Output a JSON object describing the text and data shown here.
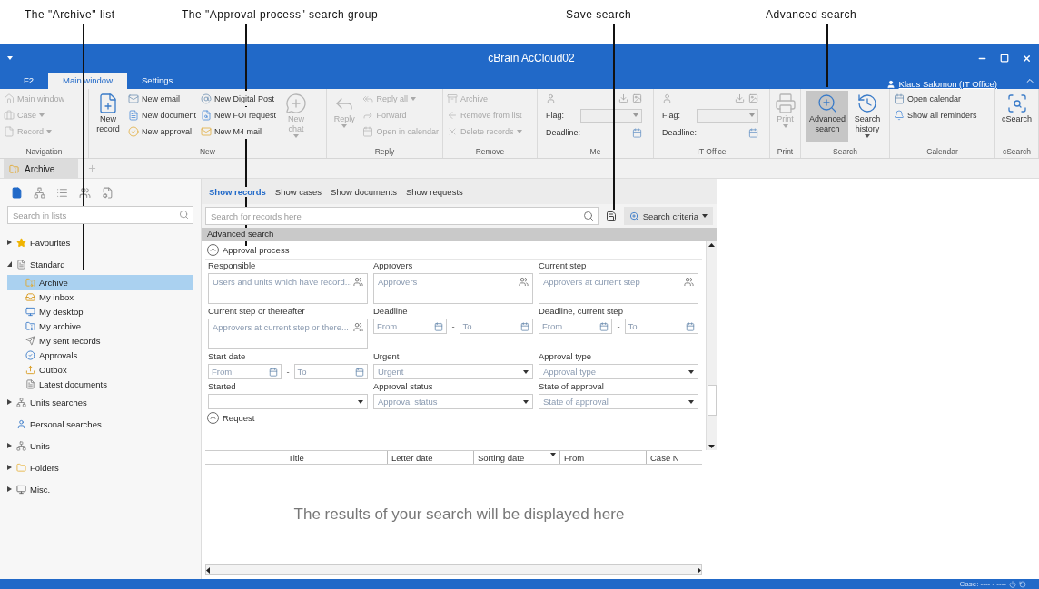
{
  "annotations": [
    {
      "text": "The \"Archive\" list"
    },
    {
      "text": "The \"Approval process\" search group"
    },
    {
      "text": "Save search"
    },
    {
      "text": "Advanced search"
    }
  ],
  "window": {
    "title": "cBrain AcCloud02"
  },
  "ribbon_tabs": [
    {
      "label": "F2",
      "selected": false
    },
    {
      "label": "Main window",
      "selected": true
    },
    {
      "label": "Settings",
      "selected": false
    }
  ],
  "user": "Klaus Salomon (IT Office)",
  "ribbon_groups": [
    {
      "label": "Navigation",
      "columns": [
        {
          "kind": "stack",
          "items": [
            {
              "label": "Main window",
              "disabled": true,
              "dropdown": false
            },
            {
              "label": "Case",
              "disabled": true,
              "dropdown": true
            },
            {
              "label": "Record",
              "disabled": true,
              "dropdown": true
            }
          ]
        }
      ]
    },
    {
      "label": "New",
      "columns": [
        {
          "kind": "large",
          "label": "New record",
          "disabled": false,
          "dropdown": false,
          "active": false
        },
        {
          "kind": "stack",
          "items": [
            {
              "label": "New email",
              "disabled": false,
              "dropdown": false
            },
            {
              "label": "New document",
              "disabled": false,
              "dropdown": false
            },
            {
              "label": "New approval",
              "disabled": false,
              "dropdown": false
            }
          ]
        },
        {
          "kind": "stack",
          "items": [
            {
              "label": "New Digital Post",
              "disabled": false,
              "dropdown": false
            },
            {
              "label": "New FOI request",
              "disabled": false,
              "dropdown": false
            },
            {
              "label": "New M4 mail",
              "disabled": false,
              "dropdown": false
            }
          ]
        },
        {
          "kind": "large",
          "label": "New chat",
          "disabled": true,
          "dropdown": true,
          "active": false
        }
      ]
    },
    {
      "label": "Reply",
      "columns": [
        {
          "kind": "large",
          "label": "Reply",
          "disabled": true,
          "dropdown": true,
          "active": false
        },
        {
          "kind": "stack",
          "items": [
            {
              "label": "Reply all",
              "disabled": true,
              "dropdown": true
            },
            {
              "label": "Forward",
              "disabled": true,
              "dropdown": false
            },
            {
              "label": "Open in calendar",
              "disabled": true,
              "dropdown": false
            }
          ]
        }
      ]
    },
    {
      "label": "Remove",
      "columns": [
        {
          "kind": "stack",
          "items": [
            {
              "label": "Archive",
              "disabled": true,
              "dropdown": false
            },
            {
              "label": "Remove from list",
              "disabled": true,
              "dropdown": false
            },
            {
              "label": "Delete records",
              "disabled": true,
              "dropdown": true
            }
          ]
        }
      ]
    },
    {
      "label": "Me",
      "columns": [
        {
          "kind": "fields",
          "flag": "Flag:",
          "deadline": "Deadline:",
          "disabled": true
        }
      ]
    },
    {
      "label": "IT Office",
      "columns": [
        {
          "kind": "fields",
          "flag": "Flag:",
          "deadline": "Deadline:",
          "disabled": true
        }
      ]
    },
    {
      "label": "Print",
      "columns": [
        {
          "kind": "large",
          "label": "Print",
          "disabled": true,
          "dropdown": true,
          "active": false
        }
      ]
    },
    {
      "label": "Search",
      "columns": [
        {
          "kind": "large",
          "label": "Advanced search",
          "disabled": false,
          "dropdown": false,
          "active": true
        },
        {
          "kind": "large",
          "label": "Search history",
          "disabled": false,
          "dropdown": true,
          "active": false
        }
      ]
    },
    {
      "label": "Calendar",
      "columns": [
        {
          "kind": "stack",
          "items": [
            {
              "label": "Open calendar",
              "disabled": false,
              "dropdown": false
            },
            {
              "label": "Show all reminders",
              "disabled": false,
              "dropdown": false
            }
          ]
        }
      ]
    },
    {
      "label": "cSearch",
      "columns": [
        {
          "kind": "large",
          "label": "cSearch",
          "disabled": false,
          "dropdown": false,
          "active": false
        }
      ]
    }
  ],
  "doc_tabs": [
    {
      "label": "Archive",
      "selected": true
    }
  ],
  "sidebar": {
    "search": {
      "placeholder": "Search in lists"
    },
    "tree": [
      {
        "label": "Favourites",
        "expanded": false,
        "selected": false
      },
      {
        "label": "Standard",
        "expanded": true,
        "selected": false,
        "children": [
          {
            "label": "Archive",
            "selected": true
          },
          {
            "label": "My inbox",
            "selected": false
          },
          {
            "label": "My desktop",
            "selected": false
          },
          {
            "label": "My archive",
            "selected": false
          },
          {
            "label": "My sent records",
            "selected": false
          },
          {
            "label": "Approvals",
            "selected": false
          },
          {
            "label": "Outbox",
            "selected": false
          },
          {
            "label": "Latest documents",
            "selected": false
          }
        ]
      },
      {
        "label": "Units searches",
        "expanded": false,
        "selected": false
      },
      {
        "label": "Personal searches",
        "selected": false
      },
      {
        "label": "Units",
        "expanded": false,
        "selected": false
      },
      {
        "label": "Folders",
        "expanded": false,
        "selected": false
      },
      {
        "label": "Misc.",
        "expanded": false,
        "selected": false
      }
    ]
  },
  "view_tabs": [
    {
      "label": "Show records",
      "selected": true
    },
    {
      "label": "Show cases",
      "selected": false
    },
    {
      "label": "Show documents",
      "selected": false
    },
    {
      "label": "Show requests",
      "selected": false
    }
  ],
  "search": {
    "placeholder": "Search for records here",
    "criteria_button": "Search criteria"
  },
  "advanced_search": {
    "title": "Advanced search",
    "sections": [
      {
        "title": "Approval process",
        "expanded": true,
        "fields": [
          {
            "kind": "people",
            "label": "Responsible",
            "placeholder": "Users and units which have record..."
          },
          {
            "kind": "people",
            "label": "Approvers",
            "placeholder": "Approvers"
          },
          {
            "kind": "people",
            "label": "Current step",
            "placeholder": "Approvers at current step"
          },
          {
            "kind": "people",
            "label": "Current step or thereafter",
            "placeholder": "Approvers at current step or there..."
          },
          {
            "kind": "daterange",
            "label": "Deadline",
            "from": "From",
            "to": "To",
            "separator": "-"
          },
          {
            "kind": "daterange",
            "label": "Deadline, current step",
            "from": "From",
            "to": "To",
            "separator": "-"
          },
          {
            "kind": "daterange",
            "label": "Start date",
            "from": "From",
            "to": "To",
            "separator": "-"
          },
          {
            "kind": "select",
            "label": "Urgent",
            "placeholder": "Urgent"
          },
          {
            "kind": "select",
            "label": "Approval type",
            "placeholder": "Approval type"
          },
          {
            "kind": "select",
            "label": "Started"
          },
          {
            "kind": "select",
            "label": "Approval status",
            "placeholder": "Approval status"
          },
          {
            "kind": "select",
            "label": "State of approval",
            "placeholder": "State of approval"
          }
        ]
      },
      {
        "title": "Request",
        "expanded": true
      }
    ]
  },
  "table": {
    "columns": [
      {
        "label": "Title",
        "sorted": false
      },
      {
        "label": "Letter date",
        "sorted": false
      },
      {
        "label": "Sorting date",
        "sorted": true
      },
      {
        "label": "From",
        "sorted": false
      },
      {
        "label": "Case N",
        "sorted": false
      }
    ],
    "empty_message": "The results of your search will be displayed here"
  },
  "status_bar": {
    "case": "Case: ---- - ----"
  }
}
